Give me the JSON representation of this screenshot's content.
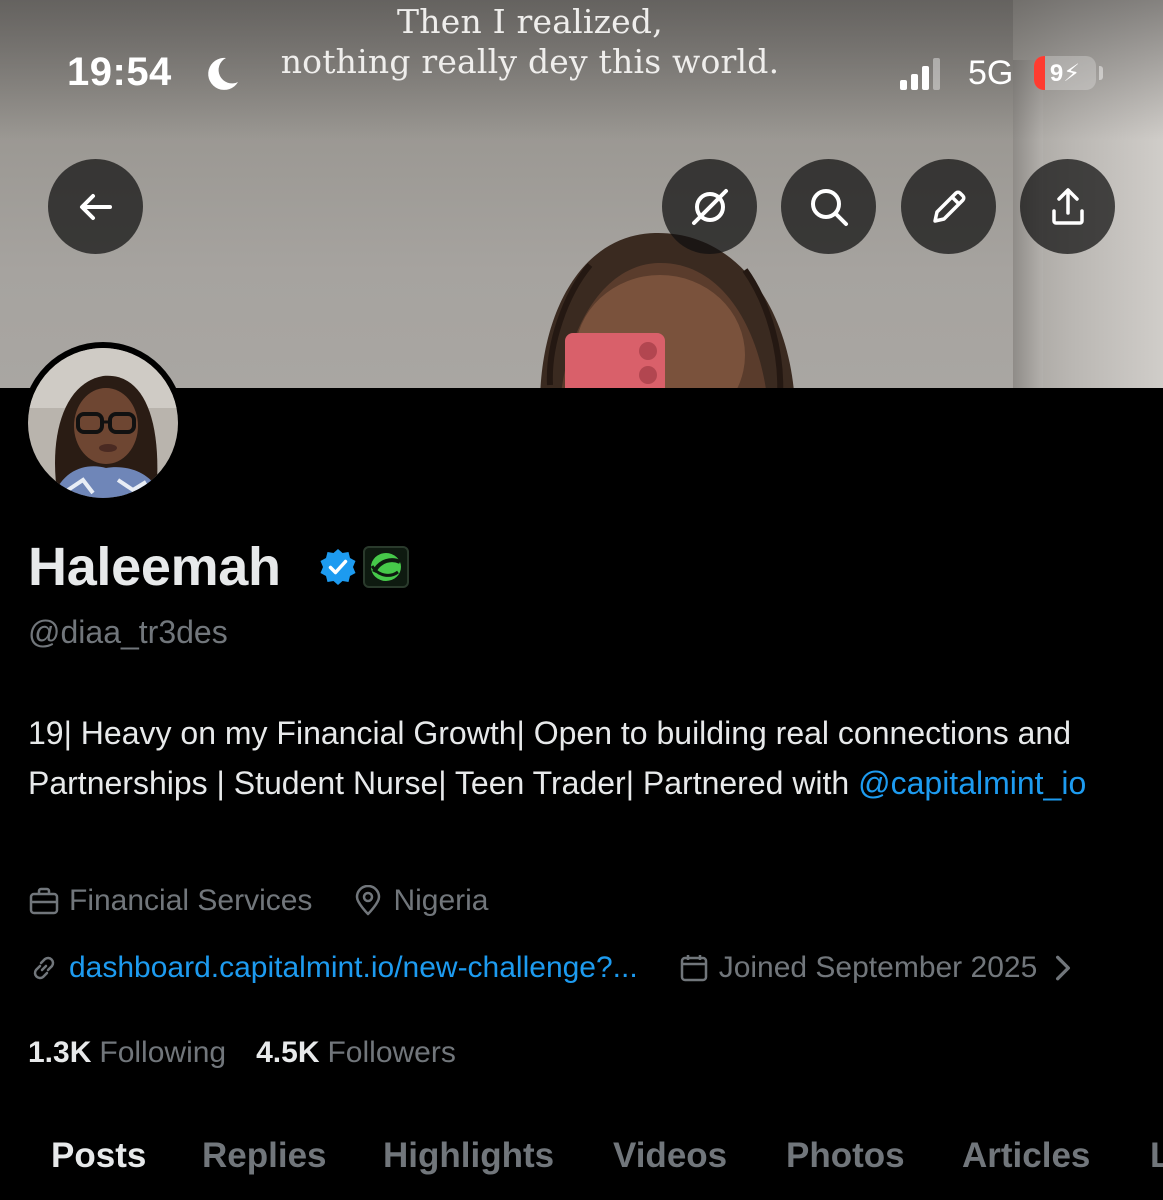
{
  "status_bar": {
    "time": "19:54",
    "network": "5G",
    "battery_label": "9",
    "battery_level": 0.09,
    "icons": [
      "moon-icon",
      "signal-icon",
      "battery-icon"
    ]
  },
  "banner": {
    "quote_line1": "Then I realized,",
    "quote_line2": "nothing really dey this world."
  },
  "header_buttons": {
    "icons": [
      "back-arrow-icon",
      "grok-icon",
      "search-icon",
      "pencil-icon",
      "share-icon"
    ]
  },
  "profile": {
    "name": "Haleemah",
    "handle": "@diaa_tr3des",
    "bio_text": "19| Heavy on my Financial Growth| Open to building real connections and Partnerships | Student Nurse| Teen Trader| Partnered with ",
    "bio_mention": "@capitalmint_io",
    "category": "Financial Services",
    "location": "Nigeria",
    "link": "dashboard.capitalmint.io/new-challenge?...",
    "joined": "Joined September 2025",
    "following_count": "1.3K",
    "following_label": "Following",
    "followers_count": "4.5K",
    "followers_label": "Followers"
  },
  "tabs": [
    {
      "label": "Posts"
    },
    {
      "label": "Replies"
    },
    {
      "label": "Highlights"
    },
    {
      "label": "Videos"
    },
    {
      "label": "Photos"
    },
    {
      "label": "Articles"
    },
    {
      "label": "L"
    }
  ],
  "colors": {
    "background": "#000000",
    "text_primary": "#e7e9ea",
    "text_secondary": "#71767b",
    "link": "#1d9bf0",
    "battery_low": "#ff3b30"
  }
}
